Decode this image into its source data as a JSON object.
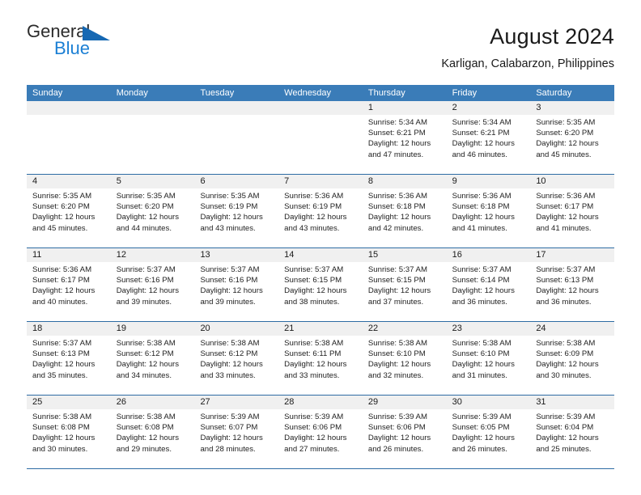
{
  "logo": {
    "word_one": "General",
    "word_two": "Blue",
    "triangle_icon": "blue-triangle-icon",
    "colors": {
      "general": "#2b2b2b",
      "blue": "#1b7fd4",
      "triangle": "#1668b3"
    }
  },
  "header": {
    "title": "August 2024",
    "subtitle": "Karligan, Calabarzon, Philippines"
  },
  "theme": {
    "header_row_bg": "#3a7cb8",
    "day_number_bg": "#f0f0f0",
    "row_divider": "#2e6ca4",
    "text": "#222222"
  },
  "weekdays": [
    "Sunday",
    "Monday",
    "Tuesday",
    "Wednesday",
    "Thursday",
    "Friday",
    "Saturday"
  ],
  "weeks": [
    [
      {
        "day": "",
        "empty": true
      },
      {
        "day": "",
        "empty": true
      },
      {
        "day": "",
        "empty": true
      },
      {
        "day": "",
        "empty": true
      },
      {
        "day": "1",
        "sunrise": "Sunrise: 5:34 AM",
        "sunset": "Sunset: 6:21 PM",
        "daylight_1": "Daylight: 12 hours",
        "daylight_2": "and 47 minutes."
      },
      {
        "day": "2",
        "sunrise": "Sunrise: 5:34 AM",
        "sunset": "Sunset: 6:21 PM",
        "daylight_1": "Daylight: 12 hours",
        "daylight_2": "and 46 minutes."
      },
      {
        "day": "3",
        "sunrise": "Sunrise: 5:35 AM",
        "sunset": "Sunset: 6:20 PM",
        "daylight_1": "Daylight: 12 hours",
        "daylight_2": "and 45 minutes."
      }
    ],
    [
      {
        "day": "4",
        "sunrise": "Sunrise: 5:35 AM",
        "sunset": "Sunset: 6:20 PM",
        "daylight_1": "Daylight: 12 hours",
        "daylight_2": "and 45 minutes."
      },
      {
        "day": "5",
        "sunrise": "Sunrise: 5:35 AM",
        "sunset": "Sunset: 6:20 PM",
        "daylight_1": "Daylight: 12 hours",
        "daylight_2": "and 44 minutes."
      },
      {
        "day": "6",
        "sunrise": "Sunrise: 5:35 AM",
        "sunset": "Sunset: 6:19 PM",
        "daylight_1": "Daylight: 12 hours",
        "daylight_2": "and 43 minutes."
      },
      {
        "day": "7",
        "sunrise": "Sunrise: 5:36 AM",
        "sunset": "Sunset: 6:19 PM",
        "daylight_1": "Daylight: 12 hours",
        "daylight_2": "and 43 minutes."
      },
      {
        "day": "8",
        "sunrise": "Sunrise: 5:36 AM",
        "sunset": "Sunset: 6:18 PM",
        "daylight_1": "Daylight: 12 hours",
        "daylight_2": "and 42 minutes."
      },
      {
        "day": "9",
        "sunrise": "Sunrise: 5:36 AM",
        "sunset": "Sunset: 6:18 PM",
        "daylight_1": "Daylight: 12 hours",
        "daylight_2": "and 41 minutes."
      },
      {
        "day": "10",
        "sunrise": "Sunrise: 5:36 AM",
        "sunset": "Sunset: 6:17 PM",
        "daylight_1": "Daylight: 12 hours",
        "daylight_2": "and 41 minutes."
      }
    ],
    [
      {
        "day": "11",
        "sunrise": "Sunrise: 5:36 AM",
        "sunset": "Sunset: 6:17 PM",
        "daylight_1": "Daylight: 12 hours",
        "daylight_2": "and 40 minutes."
      },
      {
        "day": "12",
        "sunrise": "Sunrise: 5:37 AM",
        "sunset": "Sunset: 6:16 PM",
        "daylight_1": "Daylight: 12 hours",
        "daylight_2": "and 39 minutes."
      },
      {
        "day": "13",
        "sunrise": "Sunrise: 5:37 AM",
        "sunset": "Sunset: 6:16 PM",
        "daylight_1": "Daylight: 12 hours",
        "daylight_2": "and 39 minutes."
      },
      {
        "day": "14",
        "sunrise": "Sunrise: 5:37 AM",
        "sunset": "Sunset: 6:15 PM",
        "daylight_1": "Daylight: 12 hours",
        "daylight_2": "and 38 minutes."
      },
      {
        "day": "15",
        "sunrise": "Sunrise: 5:37 AM",
        "sunset": "Sunset: 6:15 PM",
        "daylight_1": "Daylight: 12 hours",
        "daylight_2": "and 37 minutes."
      },
      {
        "day": "16",
        "sunrise": "Sunrise: 5:37 AM",
        "sunset": "Sunset: 6:14 PM",
        "daylight_1": "Daylight: 12 hours",
        "daylight_2": "and 36 minutes."
      },
      {
        "day": "17",
        "sunrise": "Sunrise: 5:37 AM",
        "sunset": "Sunset: 6:13 PM",
        "daylight_1": "Daylight: 12 hours",
        "daylight_2": "and 36 minutes."
      }
    ],
    [
      {
        "day": "18",
        "sunrise": "Sunrise: 5:37 AM",
        "sunset": "Sunset: 6:13 PM",
        "daylight_1": "Daylight: 12 hours",
        "daylight_2": "and 35 minutes."
      },
      {
        "day": "19",
        "sunrise": "Sunrise: 5:38 AM",
        "sunset": "Sunset: 6:12 PM",
        "daylight_1": "Daylight: 12 hours",
        "daylight_2": "and 34 minutes."
      },
      {
        "day": "20",
        "sunrise": "Sunrise: 5:38 AM",
        "sunset": "Sunset: 6:12 PM",
        "daylight_1": "Daylight: 12 hours",
        "daylight_2": "and 33 minutes."
      },
      {
        "day": "21",
        "sunrise": "Sunrise: 5:38 AM",
        "sunset": "Sunset: 6:11 PM",
        "daylight_1": "Daylight: 12 hours",
        "daylight_2": "and 33 minutes."
      },
      {
        "day": "22",
        "sunrise": "Sunrise: 5:38 AM",
        "sunset": "Sunset: 6:10 PM",
        "daylight_1": "Daylight: 12 hours",
        "daylight_2": "and 32 minutes."
      },
      {
        "day": "23",
        "sunrise": "Sunrise: 5:38 AM",
        "sunset": "Sunset: 6:10 PM",
        "daylight_1": "Daylight: 12 hours",
        "daylight_2": "and 31 minutes."
      },
      {
        "day": "24",
        "sunrise": "Sunrise: 5:38 AM",
        "sunset": "Sunset: 6:09 PM",
        "daylight_1": "Daylight: 12 hours",
        "daylight_2": "and 30 minutes."
      }
    ],
    [
      {
        "day": "25",
        "sunrise": "Sunrise: 5:38 AM",
        "sunset": "Sunset: 6:08 PM",
        "daylight_1": "Daylight: 12 hours",
        "daylight_2": "and 30 minutes."
      },
      {
        "day": "26",
        "sunrise": "Sunrise: 5:38 AM",
        "sunset": "Sunset: 6:08 PM",
        "daylight_1": "Daylight: 12 hours",
        "daylight_2": "and 29 minutes."
      },
      {
        "day": "27",
        "sunrise": "Sunrise: 5:39 AM",
        "sunset": "Sunset: 6:07 PM",
        "daylight_1": "Daylight: 12 hours",
        "daylight_2": "and 28 minutes."
      },
      {
        "day": "28",
        "sunrise": "Sunrise: 5:39 AM",
        "sunset": "Sunset: 6:06 PM",
        "daylight_1": "Daylight: 12 hours",
        "daylight_2": "and 27 minutes."
      },
      {
        "day": "29",
        "sunrise": "Sunrise: 5:39 AM",
        "sunset": "Sunset: 6:06 PM",
        "daylight_1": "Daylight: 12 hours",
        "daylight_2": "and 26 minutes."
      },
      {
        "day": "30",
        "sunrise": "Sunrise: 5:39 AM",
        "sunset": "Sunset: 6:05 PM",
        "daylight_1": "Daylight: 12 hours",
        "daylight_2": "and 26 minutes."
      },
      {
        "day": "31",
        "sunrise": "Sunrise: 5:39 AM",
        "sunset": "Sunset: 6:04 PM",
        "daylight_1": "Daylight: 12 hours",
        "daylight_2": "and 25 minutes."
      }
    ]
  ]
}
